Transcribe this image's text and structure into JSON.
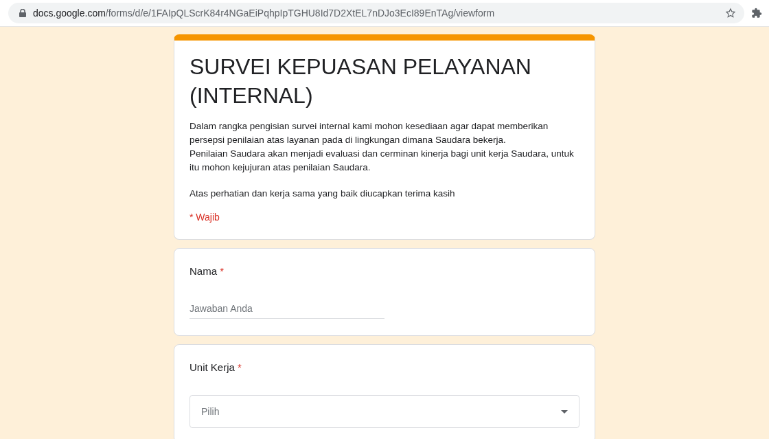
{
  "browser": {
    "url_host": "docs.google.com",
    "url_path": "/forms/d/e/1FAIpQLScrK84r4NGaEiPqhpIpTGHU8Id7D2XtEL7nDJo3EcI89EnTAg/viewform"
  },
  "form": {
    "title": "SURVEI KEPUASAN PELAYANAN (INTERNAL)",
    "description": [
      [
        "Dalam rangka pengisian survei internal kami mohon kesediaan agar dapat memberikan persepsi penilaian atas layanan pada di lingkungan dimana Saudara bekerja.",
        "Penilaian Saudara akan menjadi evaluasi dan cerminan kinerja bagi unit kerja Saudara, untuk itu mohon kejujuran atas penilaian Saudara."
      ],
      [
        "Atas perhatian dan kerja sama yang baik diucapkan terima kasih"
      ]
    ],
    "required_legend": "* Wajib"
  },
  "questions": [
    {
      "kind": "text",
      "label": "Nama",
      "required_mark": "*",
      "placeholder": "Jawaban Anda"
    },
    {
      "kind": "select",
      "label": "Unit Kerja",
      "required_mark": "*",
      "placeholder": "Pilih"
    }
  ]
}
